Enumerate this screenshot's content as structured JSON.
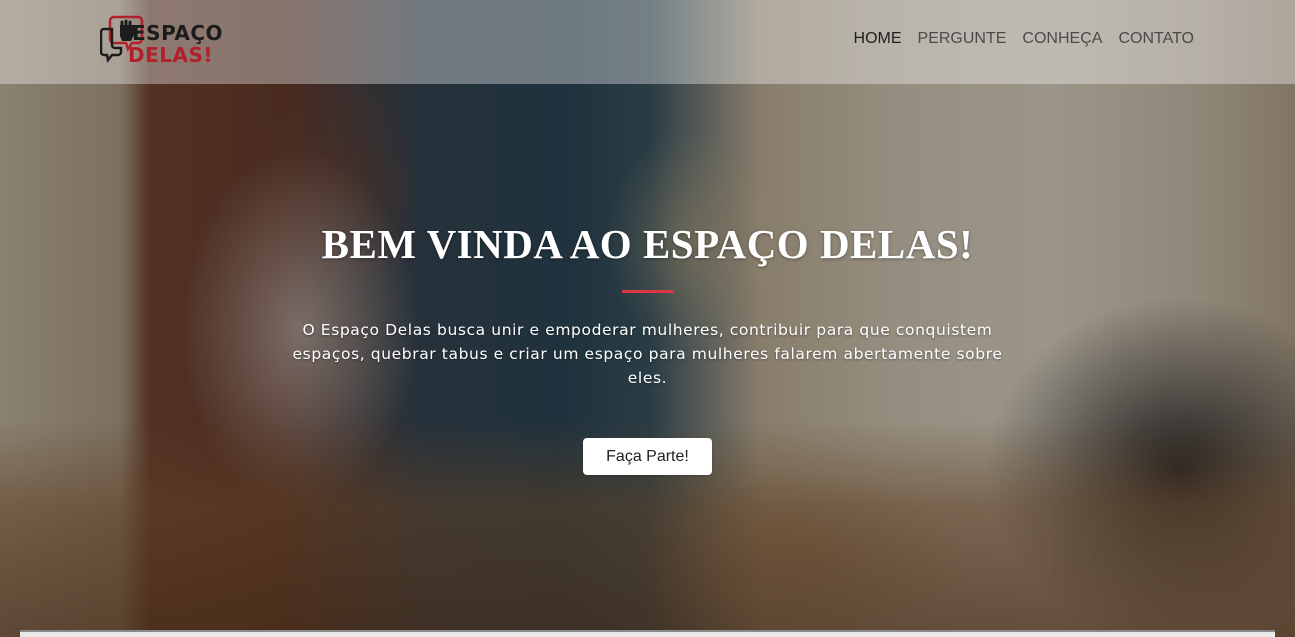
{
  "logo": {
    "line1": "ESPAÇO",
    "line2": "DELAS!",
    "icon": "fist-speech-bubble-icon"
  },
  "nav": {
    "items": [
      {
        "label": "HOME",
        "active": true
      },
      {
        "label": "PERGUNTE",
        "active": false
      },
      {
        "label": "CONHEÇA",
        "active": false
      },
      {
        "label": "CONTATO",
        "active": false
      }
    ]
  },
  "hero": {
    "title": "BEM VINDA AO ESPAÇO DELAS!",
    "text": "O Espaço Delas busca unir e empoderar mulheres, contribuir para que conquistem espaços, quebrar tabus e criar um espaço para mulheres falarem abertamente sobre eles.",
    "button_label": "Faça Parte!"
  },
  "colors": {
    "accent": "#dc3545",
    "logo_red": "#b1202b",
    "logo_dark": "#1c1c1c"
  }
}
